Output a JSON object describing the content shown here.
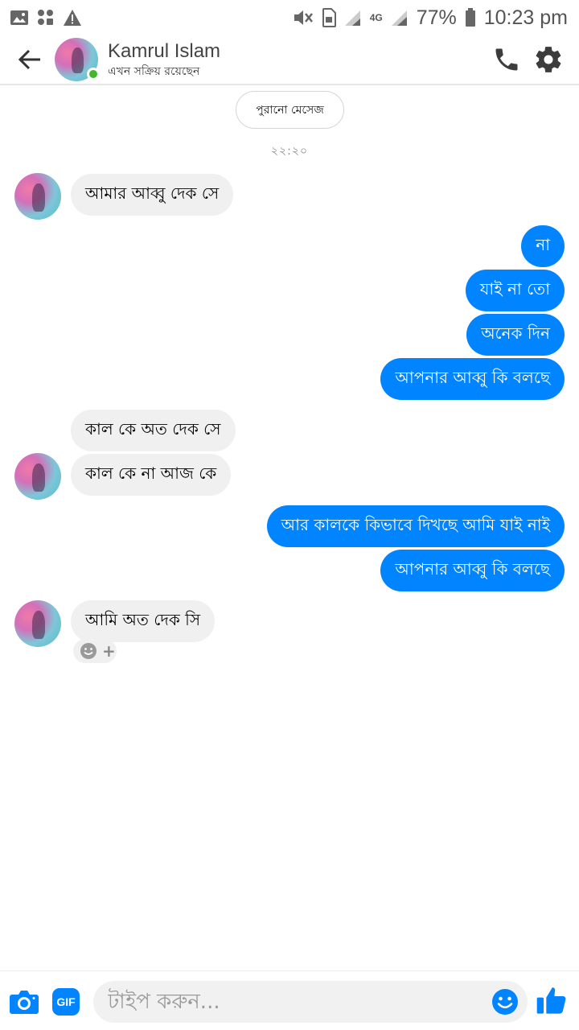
{
  "status_bar": {
    "battery_percent": "77%",
    "time": "10:23 pm",
    "network": "4G",
    "icons": [
      "gallery-icon",
      "apps-icon",
      "warning-icon",
      "mute-icon",
      "sim-icon",
      "signal-icon",
      "battery-icon"
    ]
  },
  "header": {
    "contact_name": "Kamrul Islam",
    "status_text": "এখন সক্রিয় রয়েছেন",
    "online": true
  },
  "conversation": {
    "older_messages_label": "পুরানো মেসেজ",
    "timestamp": "২২:২০",
    "messages": [
      {
        "from": "contact",
        "text": "আমার আব্বু দেক সে"
      },
      {
        "from": "me",
        "text": "না"
      },
      {
        "from": "me",
        "text": "যাই না তো"
      },
      {
        "from": "me",
        "text": "অনেক দিন"
      },
      {
        "from": "me",
        "text": "আপনার আব্বু কি বলছে"
      },
      {
        "from": "contact",
        "text": "কাল কে অত দেক সে"
      },
      {
        "from": "contact",
        "text": "কাল কে না আজ কে"
      },
      {
        "from": "me",
        "text": "আর কালকে কিভাবে দিখছে আমি যাই নাই"
      },
      {
        "from": "me",
        "text": "আপনার আব্বু কি বলছে"
      },
      {
        "from": "contact",
        "text": "আমি অত দেক সি"
      }
    ]
  },
  "composer": {
    "placeholder": "টাইপ করুন...",
    "gif_label": "GIF"
  },
  "colors": {
    "accent": "#0084ff",
    "incoming_bubble": "#f0f0f0",
    "online": "#42b72a"
  }
}
